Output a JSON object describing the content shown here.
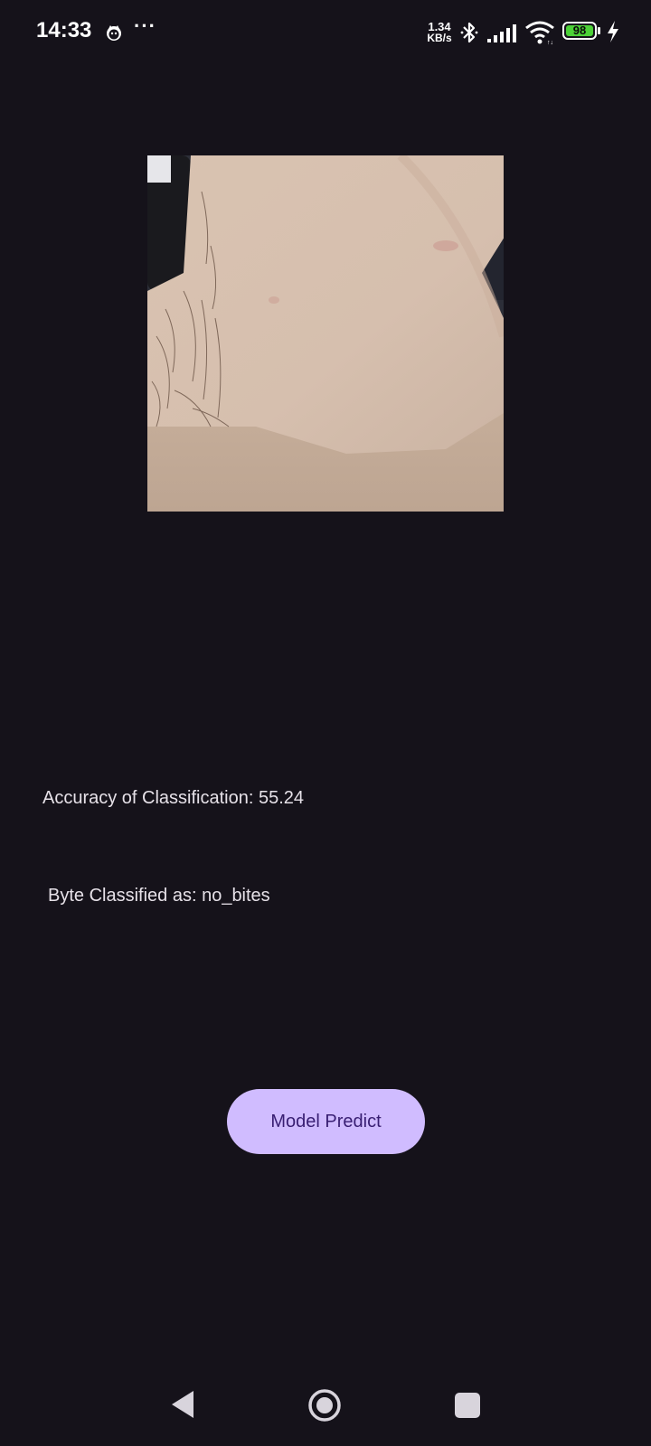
{
  "status_bar": {
    "time": "14:33",
    "more": "···",
    "net_speed_value": "1.34",
    "net_speed_unit": "KB/s",
    "battery_level": "98",
    "icons": [
      "app-notification-icon",
      "bluetooth-icon",
      "signal-icon",
      "wifi-icon",
      "battery-icon",
      "charging-icon"
    ]
  },
  "photo": {
    "description_icon": "captured-skin-image"
  },
  "result": {
    "accuracy_text": "Accuracy of Classification: 55.24",
    "class_text": "Byte Classified as: no_bites"
  },
  "actions": {
    "predict_label": "Model Predict"
  },
  "nav": {
    "icons": [
      "back-icon",
      "home-icon",
      "recents-icon"
    ]
  },
  "colors": {
    "background": "#15121a",
    "button_bg": "#d0bcff",
    "button_text": "#381e72",
    "battery": "#4cd137"
  }
}
